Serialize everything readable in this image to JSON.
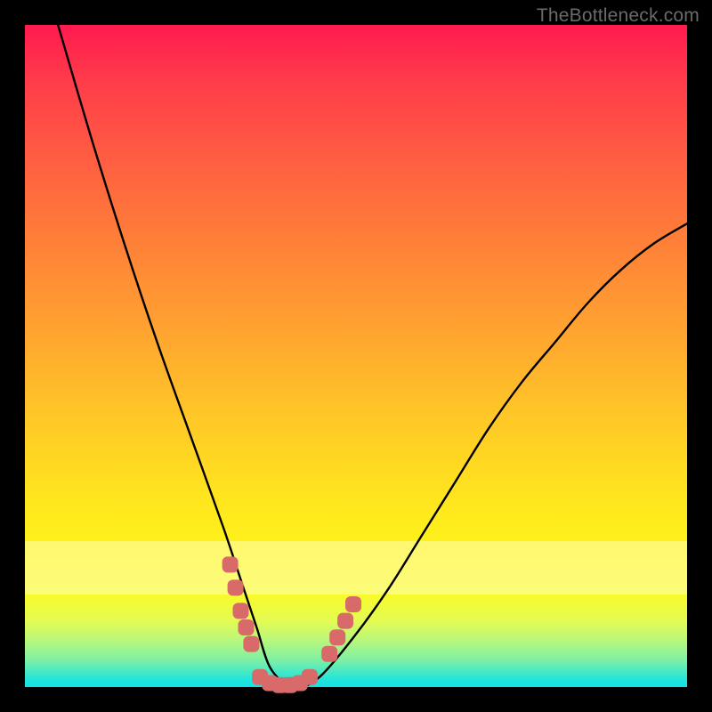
{
  "watermark": "TheBottleneck.com",
  "chart_data": {
    "type": "line",
    "title": "",
    "xlabel": "",
    "ylabel": "",
    "xlim": [
      0,
      100
    ],
    "ylim": [
      0,
      100
    ],
    "background_gradient": [
      "#ff1a4f",
      "#ff8038",
      "#ffe21f",
      "#14e1e4"
    ],
    "series": [
      {
        "name": "bottleneck-curve",
        "color": "#000000",
        "x": [
          5,
          10,
          15,
          20,
          25,
          30,
          33,
          35,
          37,
          40,
          42,
          45,
          50,
          55,
          60,
          65,
          70,
          75,
          80,
          85,
          90,
          95,
          100
        ],
        "y": [
          100,
          83,
          67,
          52,
          38,
          24,
          15,
          9,
          3,
          0,
          0,
          2,
          8,
          15,
          23,
          31,
          39,
          46,
          52,
          58,
          63,
          67,
          70
        ]
      },
      {
        "name": "marker-left-upper",
        "type": "scatter",
        "color": "#d86a6a",
        "x": [
          31.0,
          31.8,
          32.6,
          33.4,
          34.2
        ],
        "y": [
          18.5,
          15.0,
          11.5,
          9.0,
          6.5
        ]
      },
      {
        "name": "marker-bottom",
        "type": "scatter",
        "color": "#d86a6a",
        "x": [
          35.5,
          37.0,
          38.5,
          40.0,
          41.5,
          43.0
        ],
        "y": [
          1.5,
          0.6,
          0.3,
          0.3,
          0.6,
          1.5
        ]
      },
      {
        "name": "marker-right-upper",
        "type": "scatter",
        "color": "#d86a6a",
        "x": [
          46.0,
          47.2,
          48.4,
          49.6
        ],
        "y": [
          5.0,
          7.5,
          10.0,
          12.5
        ]
      }
    ]
  }
}
